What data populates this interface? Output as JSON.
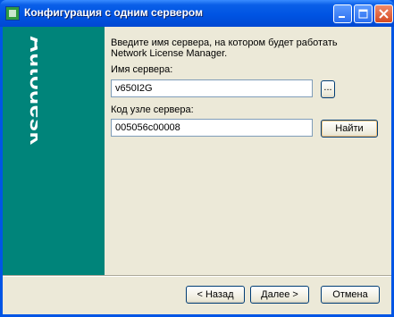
{
  "window": {
    "title": "Конфигурация с одним сервером",
    "side_brand": "Autodesk",
    "colors": {
      "titlebar": "#0054E3",
      "sidebar": "#00847A",
      "dialog": "#ECE9D8"
    }
  },
  "main": {
    "description": "Введите имя сервера, на котором будет работать Network License Manager.",
    "server_name_label": "Имя сервера:",
    "server_name_value": "v650I2G",
    "browse_label": "...",
    "host_id_label": "Код узле сервера:",
    "host_id_value": "005056c00008",
    "find_label": "Найти"
  },
  "footer": {
    "back_label": "< Назад",
    "next_label": "Далее >",
    "cancel_label": "Отмена"
  }
}
